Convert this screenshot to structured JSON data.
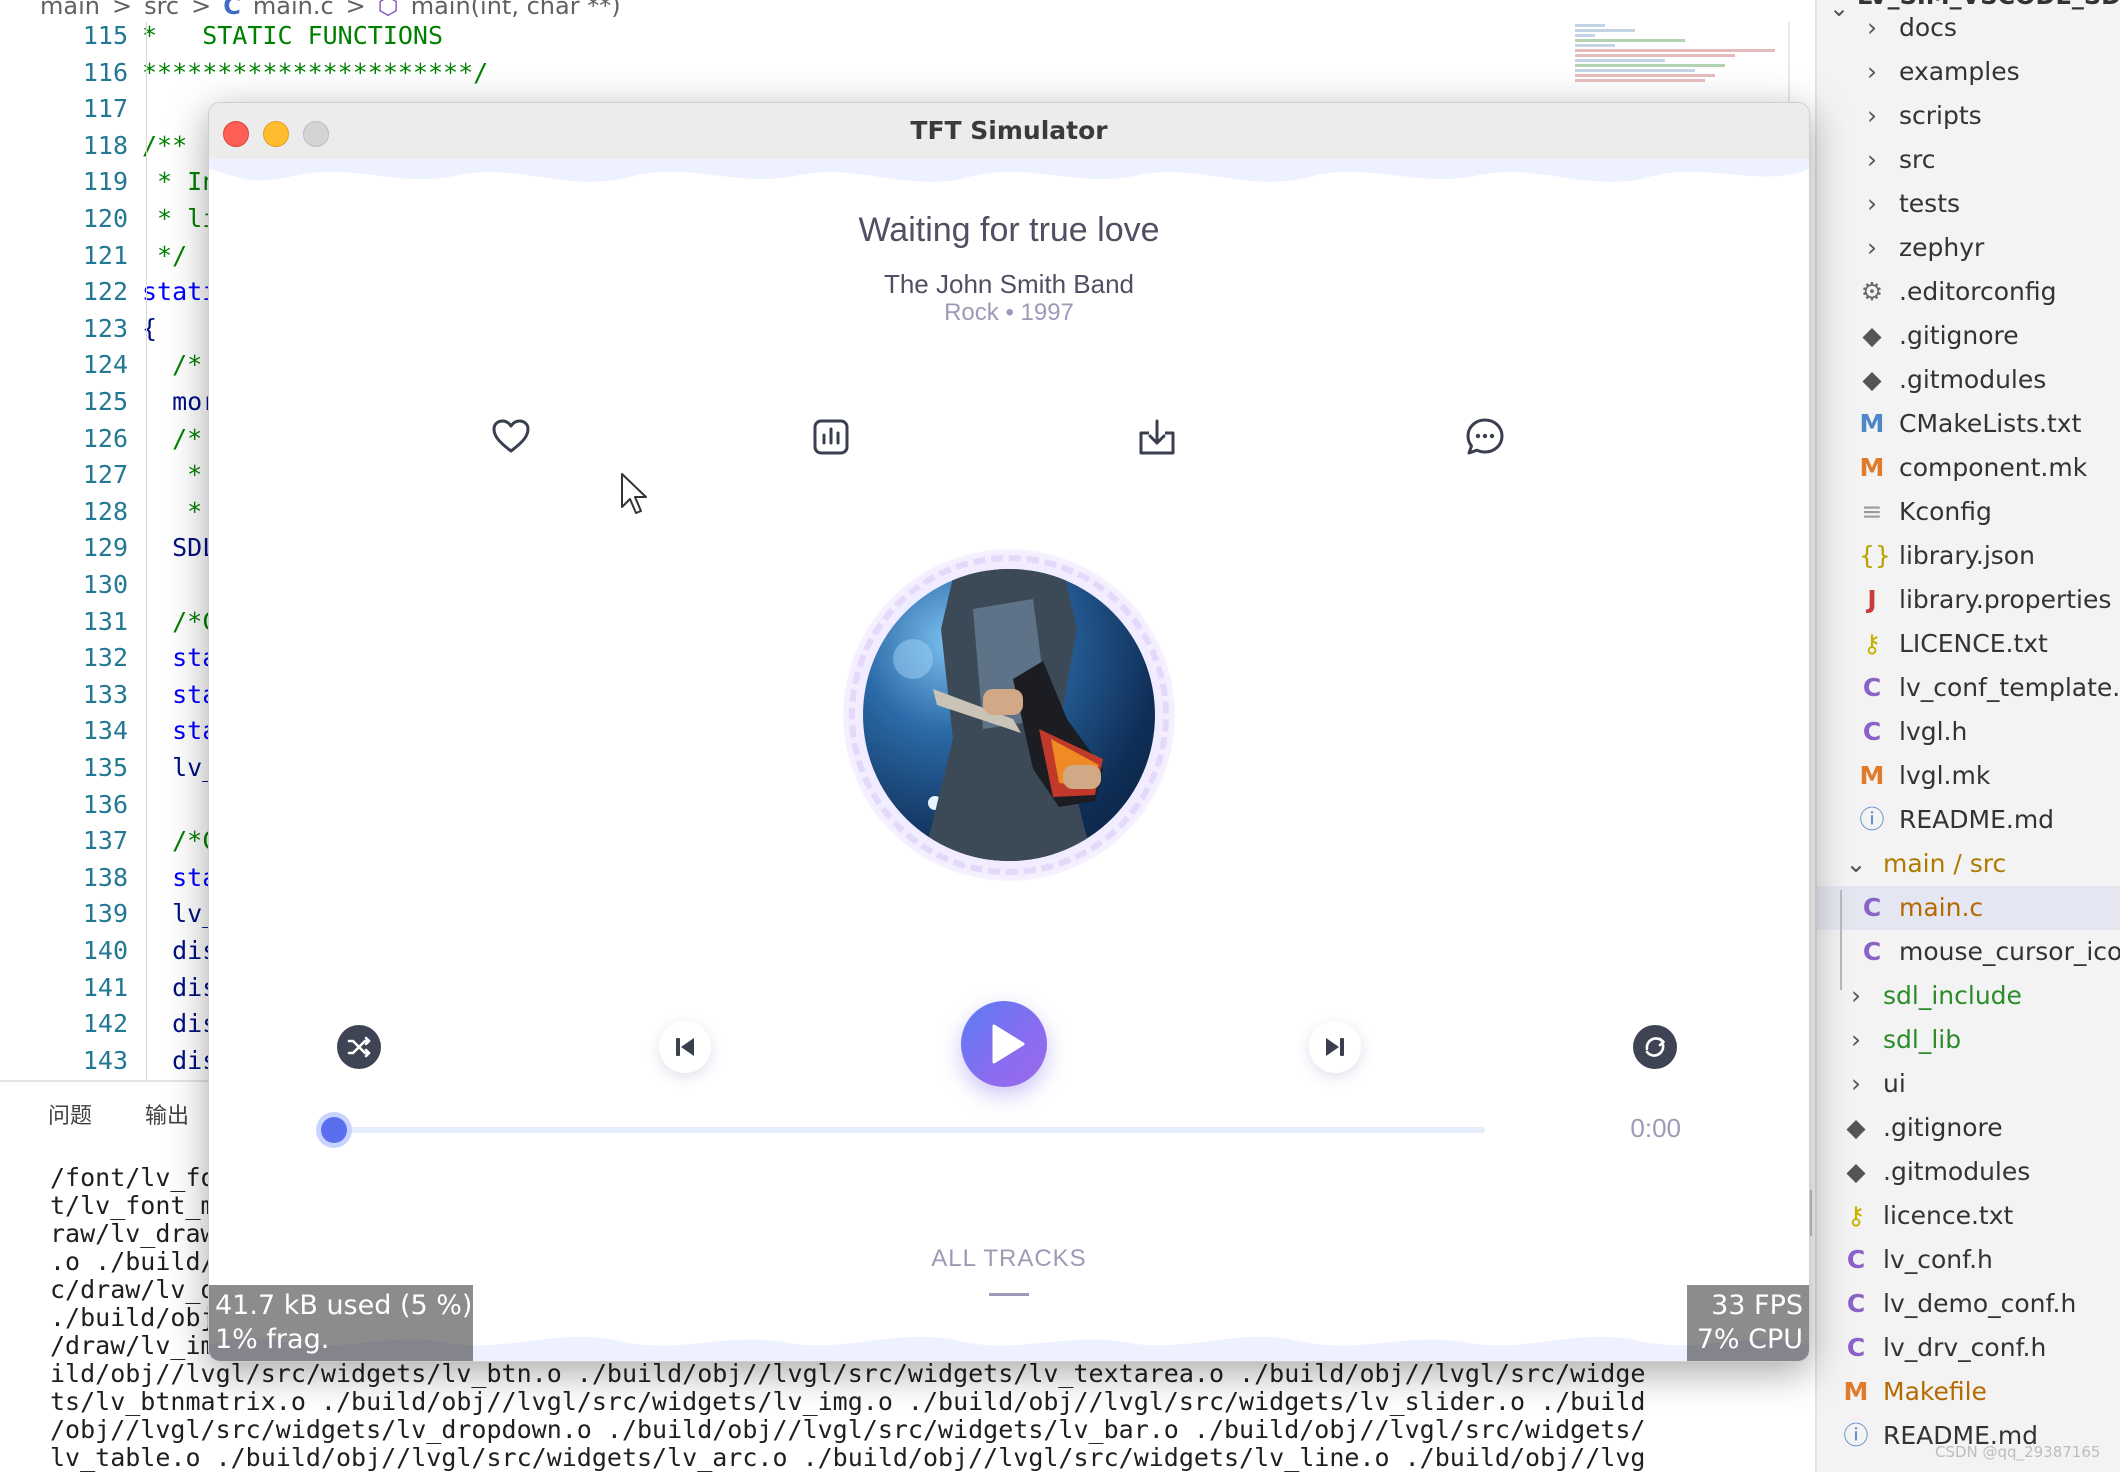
{
  "editor": {
    "breadcrumb": [
      "main",
      ">",
      "src",
      ">",
      "C",
      "main.c",
      ">",
      "⬡",
      "main(int, char **)"
    ],
    "code_lines": [
      {
        "no": "115",
        "text": "*   STATIC FUNCTIONS",
        "kind": "comment"
      },
      {
        "no": "116",
        "text": "**********************/",
        "kind": "comment"
      },
      {
        "no": "117",
        "text": "",
        "kind": "plain"
      },
      {
        "no": "118",
        "text": "/**",
        "kind": "comment"
      },
      {
        "no": "119",
        "text": " * In",
        "kind": "comment"
      },
      {
        "no": "120",
        "text": " * li",
        "kind": "comment"
      },
      {
        "no": "121",
        "text": " */",
        "kind": "comment"
      },
      {
        "no": "122",
        "text": "stati",
        "kind": "keyword"
      },
      {
        "no": "123",
        "text": "{",
        "kind": "plain"
      },
      {
        "no": "124",
        "text": "  /*",
        "kind": "comment"
      },
      {
        "no": "125",
        "text": "  mor",
        "kind": "plain"
      },
      {
        "no": "126",
        "text": "  /*",
        "kind": "comment"
      },
      {
        "no": "127",
        "text": "   *",
        "kind": "comment"
      },
      {
        "no": "128",
        "text": "   *",
        "kind": "comment"
      },
      {
        "no": "129",
        "text": "  SDL",
        "kind": "plain"
      },
      {
        "no": "130",
        "text": "",
        "kind": "plain"
      },
      {
        "no": "131",
        "text": "  /*C",
        "kind": "comment"
      },
      {
        "no": "132",
        "text": "  sta",
        "kind": "keyword"
      },
      {
        "no": "133",
        "text": "  sta",
        "kind": "keyword"
      },
      {
        "no": "134",
        "text": "  sta",
        "kind": "keyword"
      },
      {
        "no": "135",
        "text": "  lv_",
        "kind": "plain"
      },
      {
        "no": "136",
        "text": "",
        "kind": "plain"
      },
      {
        "no": "137",
        "text": "  /*C",
        "kind": "comment"
      },
      {
        "no": "138",
        "text": "  sta",
        "kind": "keyword"
      },
      {
        "no": "139",
        "text": "  lv_",
        "kind": "plain"
      },
      {
        "no": "140",
        "text": "  dis",
        "kind": "plain"
      },
      {
        "no": "141",
        "text": "  dis",
        "kind": "plain"
      },
      {
        "no": "142",
        "text": "  dis",
        "kind": "plain"
      },
      {
        "no": "143",
        "text": "  dis",
        "kind": "plain"
      }
    ]
  },
  "panel": {
    "tabs": [
      "问题",
      "输出"
    ],
    "terminal_lines": [
      "/font/lv_fon",
      "t/lv_font_mo",
      "raw/lv_draw_",
      ".o ./build/o",
      "c/draw/lv_d",
      "./build/obj",
      "/draw/lv_img",
      "ild/obj//lvgl/src/widgets/lv_btn.o ./build/obj//lvgl/src/widgets/lv_textarea.o ./build/obj//lvgl/src/widge",
      "ts/lv_btnmatrix.o ./build/obj//lvgl/src/widgets/lv_img.o ./build/obj//lvgl/src/widgets/lv_slider.o ./build",
      "/obj//lvgl/src/widgets/lv_dropdown.o ./build/obj//lvgl/src/widgets/lv_bar.o ./build/obj//lvgl/src/widgets/",
      "lv_table.o ./build/obj//lvgl/src/widgets/lv_arc.o ./build/obj//lvgl/src/widgets/lv_line.o ./build/obj//lvg"
    ]
  },
  "explorer": {
    "title": "LV_SIM_VSCODE_SDL",
    "items": [
      {
        "label": "docs",
        "icon": "chevron-right",
        "glyph": "›",
        "depth": 1,
        "style": ""
      },
      {
        "label": "examples",
        "icon": "chevron-right",
        "glyph": "›",
        "depth": 1,
        "style": ""
      },
      {
        "label": "scripts",
        "icon": "chevron-right",
        "glyph": "›",
        "depth": 1,
        "style": ""
      },
      {
        "label": "src",
        "icon": "chevron-right",
        "glyph": "›",
        "depth": 1,
        "style": ""
      },
      {
        "label": "tests",
        "icon": "chevron-right",
        "glyph": "›",
        "depth": 1,
        "style": ""
      },
      {
        "label": "zephyr",
        "icon": "chevron-right",
        "glyph": "›",
        "depth": 1,
        "style": ""
      },
      {
        "label": ".editorconfig",
        "icon": "gear",
        "glyph": "⚙",
        "depth": 1,
        "style": ""
      },
      {
        "label": ".gitignore",
        "icon": "git",
        "glyph": "◆",
        "depth": 1,
        "style": ""
      },
      {
        "label": ".gitmodules",
        "icon": "git",
        "glyph": "◆",
        "depth": 1,
        "style": ""
      },
      {
        "label": "CMakeLists.txt",
        "icon": "m-blue",
        "glyph": "M",
        "depth": 1,
        "style": ""
      },
      {
        "label": "component.mk",
        "icon": "m-orange",
        "glyph": "M",
        "depth": 1,
        "style": ""
      },
      {
        "label": "Kconfig",
        "icon": "lines",
        "glyph": "≡",
        "depth": 1,
        "style": ""
      },
      {
        "label": "library.json",
        "icon": "json",
        "glyph": "{}",
        "depth": 1,
        "style": ""
      },
      {
        "label": "library.properties",
        "icon": "j-red",
        "glyph": "J",
        "depth": 1,
        "style": ""
      },
      {
        "label": "LICENCE.txt",
        "icon": "key",
        "glyph": "⚷",
        "depth": 1,
        "style": ""
      },
      {
        "label": "lv_conf_template.h",
        "icon": "c-purple",
        "glyph": "C",
        "depth": 1,
        "style": ""
      },
      {
        "label": "lvgl.h",
        "icon": "c-purple",
        "glyph": "C",
        "depth": 1,
        "style": ""
      },
      {
        "label": "lvgl.mk",
        "icon": "m-orange",
        "glyph": "M",
        "depth": 1,
        "style": ""
      },
      {
        "label": "README.md",
        "icon": "info",
        "glyph": "ⓘ",
        "depth": 1,
        "style": ""
      },
      {
        "label": "main / src",
        "icon": "chevron-down",
        "glyph": "⌄",
        "depth": 0,
        "style": "yellow"
      },
      {
        "label": "main.c",
        "icon": "c-purple",
        "glyph": "C",
        "depth": 1,
        "style": "orange",
        "selected": true
      },
      {
        "label": "mouse_cursor_icon.c",
        "icon": "c-purple",
        "glyph": "C",
        "depth": 1,
        "style": ""
      },
      {
        "label": "sdl_include",
        "icon": "chevron-right",
        "glyph": "›",
        "depth": 0,
        "style": "green"
      },
      {
        "label": "sdl_lib",
        "icon": "chevron-right",
        "glyph": "›",
        "depth": 0,
        "style": "green"
      },
      {
        "label": "ui",
        "icon": "chevron-right",
        "glyph": "›",
        "depth": 0,
        "style": ""
      },
      {
        "label": ".gitignore",
        "icon": "git",
        "glyph": "◆",
        "depth": 0,
        "style": ""
      },
      {
        "label": ".gitmodules",
        "icon": "git",
        "glyph": "◆",
        "depth": 0,
        "style": ""
      },
      {
        "label": "licence.txt",
        "icon": "key",
        "glyph": "⚷",
        "depth": 0,
        "style": ""
      },
      {
        "label": "lv_conf.h",
        "icon": "c-purple",
        "glyph": "C",
        "depth": 0,
        "style": ""
      },
      {
        "label": "lv_demo_conf.h",
        "icon": "c-purple",
        "glyph": "C",
        "depth": 0,
        "style": ""
      },
      {
        "label": "lv_drv_conf.h",
        "icon": "c-purple",
        "glyph": "C",
        "depth": 0,
        "style": ""
      },
      {
        "label": "Makefile",
        "icon": "m-orange",
        "glyph": "M",
        "depth": 0,
        "style": "orange"
      },
      {
        "label": "README.md",
        "icon": "info",
        "glyph": "ⓘ",
        "depth": 0,
        "style": ""
      }
    ],
    "watermark": "CSDN @qq_29387165"
  },
  "simulator": {
    "window_title": "TFT Simulator",
    "song_title": "Waiting for true love",
    "artist": "The John Smith Band",
    "genre": "Rock • 1997",
    "action_icons": [
      "heart-icon",
      "chart-icon",
      "download-icon",
      "chat-icon"
    ],
    "time": "0:00",
    "progress": 0,
    "all_tracks_label": "ALL TRACKS",
    "mem_used": "41.7 kB used (5 %)",
    "mem_frag": "1% frag.",
    "fps": "33 FPS",
    "cpu": "7% CPU",
    "colors": {
      "accent": "#5a6ef0",
      "play_gradient_end": "#9a6ae8",
      "text": "#504f63",
      "muted": "#9b9bb8"
    }
  }
}
